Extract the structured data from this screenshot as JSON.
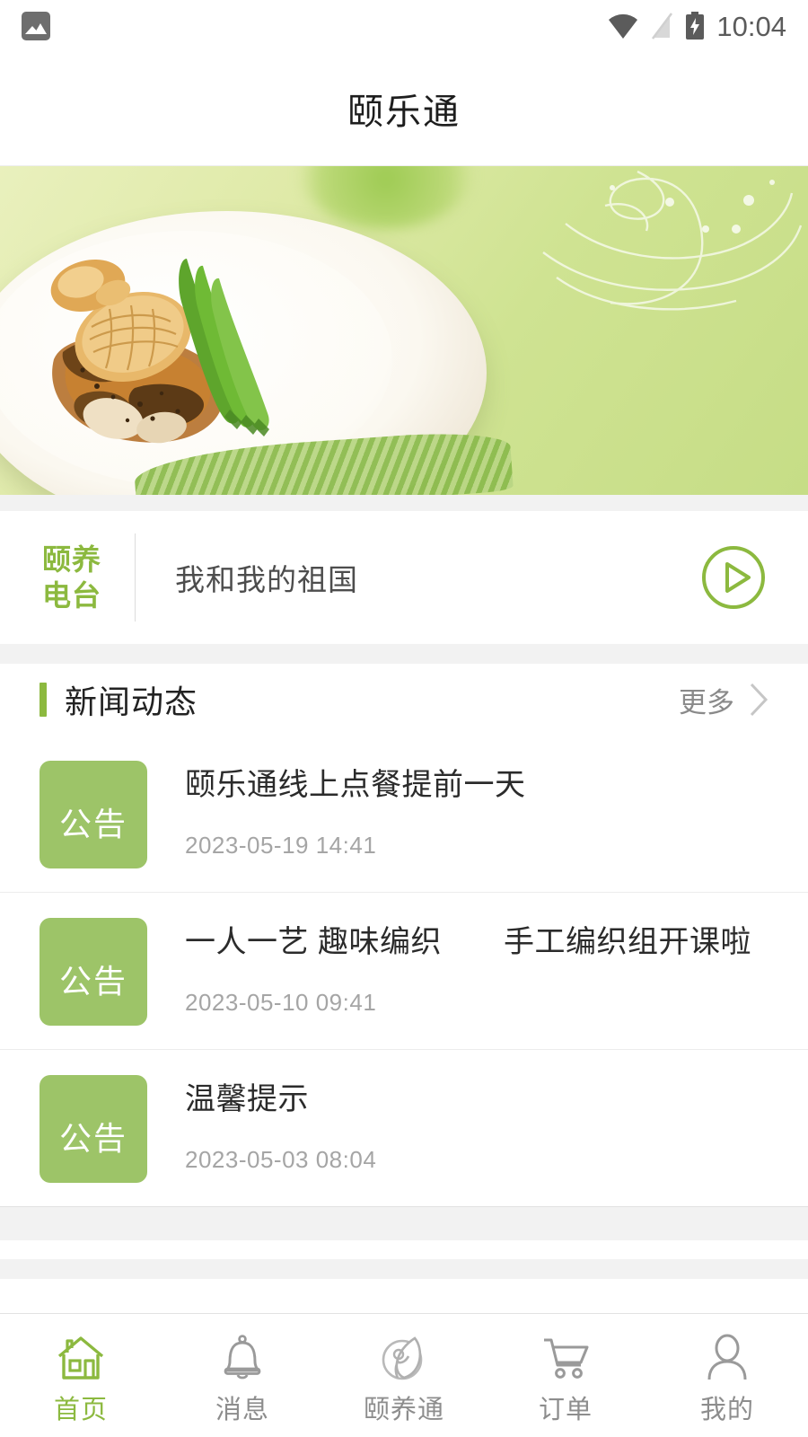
{
  "statusbar": {
    "notification_icon": "photo-icon",
    "wifi_icon": "wifi-icon",
    "signal_icon": "signal-off-icon",
    "battery_icon": "battery-charging-icon",
    "time": "10:04"
  },
  "header": {
    "title": "颐乐通"
  },
  "banner": {
    "alt": "food-plate-banner",
    "description": "白盘中的鲍鱼配芦笋"
  },
  "radio": {
    "brand_line1": "颐养",
    "brand_line2": "电台",
    "track_title": "我和我的祖国",
    "play_icon": "play-icon"
  },
  "news_section": {
    "title": "新闻动态",
    "more_label": "更多",
    "more_icon": "chevron-right-icon",
    "items": [
      {
        "badge": "公告",
        "title": "颐乐通线上点餐提前一天",
        "date": "2023-05-19 14:41"
      },
      {
        "badge": "公告",
        "title": " 一人一艺 趣味编织　　手工编织组开课啦",
        "date": "2023-05-10 09:41"
      },
      {
        "badge": "公告",
        "title": "温馨提示",
        "date": "2023-05-03 08:04"
      }
    ]
  },
  "tabbar": {
    "items": [
      {
        "label": "首页",
        "icon": "home-icon",
        "active": true
      },
      {
        "label": "消息",
        "icon": "bell-icon",
        "active": false
      },
      {
        "label": "颐养通",
        "icon": "lotus-logo-icon",
        "active": false
      },
      {
        "label": "订单",
        "icon": "cart-icon",
        "active": false
      },
      {
        "label": "我的",
        "icon": "person-icon",
        "active": false
      }
    ]
  },
  "colors": {
    "accent_green": "#8cb93f",
    "badge_green": "#9dc468",
    "page_bg": "#f2f2f2",
    "text_primary": "#2b2b2b",
    "text_muted": "#a5a5a5"
  }
}
